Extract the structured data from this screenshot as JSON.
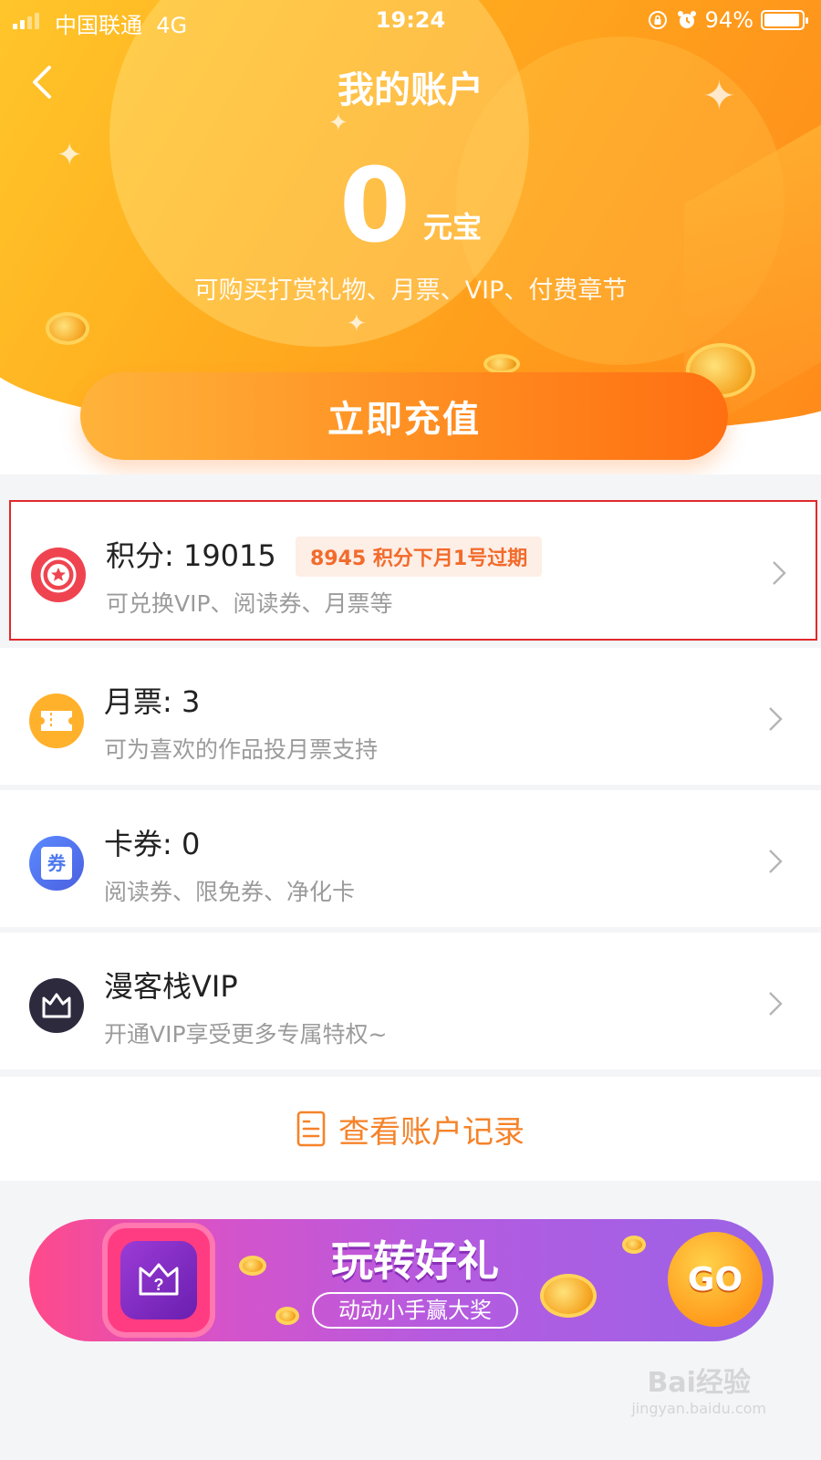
{
  "status_bar": {
    "carrier": "中国联通",
    "network": "4G",
    "time": "19:24",
    "battery": "94%",
    "battery_level": 0.94
  },
  "header": {
    "title": "我的账户",
    "balance_value": "0",
    "balance_unit": "元宝",
    "balance_desc": "可购买打赏礼物、月票、VIP、付费章节",
    "recharge_label": "立即充值"
  },
  "accounts": [
    {
      "title": "积分: 19015",
      "badge": "8945 积分下月1号过期",
      "desc": "可兑换VIP、阅读券、月票等",
      "icon": "points-icon",
      "color": "#ef4450"
    },
    {
      "title": "月票: 3",
      "desc": "可为喜欢的作品投月票支持",
      "icon": "monthly-ticket-icon",
      "color": "#ffb12b"
    },
    {
      "title": "卡券: 0",
      "desc": "阅读券、限免券、净化卡",
      "icon": "coupon-icon",
      "icon_text": "券",
      "color": "#4d78ee"
    },
    {
      "title": "漫客栈VIP",
      "desc": "开通VIP享受更多专属特权~",
      "icon": "crown-icon",
      "color": "#2e2a3e"
    }
  ],
  "records": {
    "label": "查看账户记录"
  },
  "banner": {
    "title": "玩转好礼",
    "subtitle": "动动小手赢大奖",
    "go_label": "GO"
  },
  "watermark": {
    "brand": "Bai经验",
    "url": "jingyan.baidu.com"
  }
}
